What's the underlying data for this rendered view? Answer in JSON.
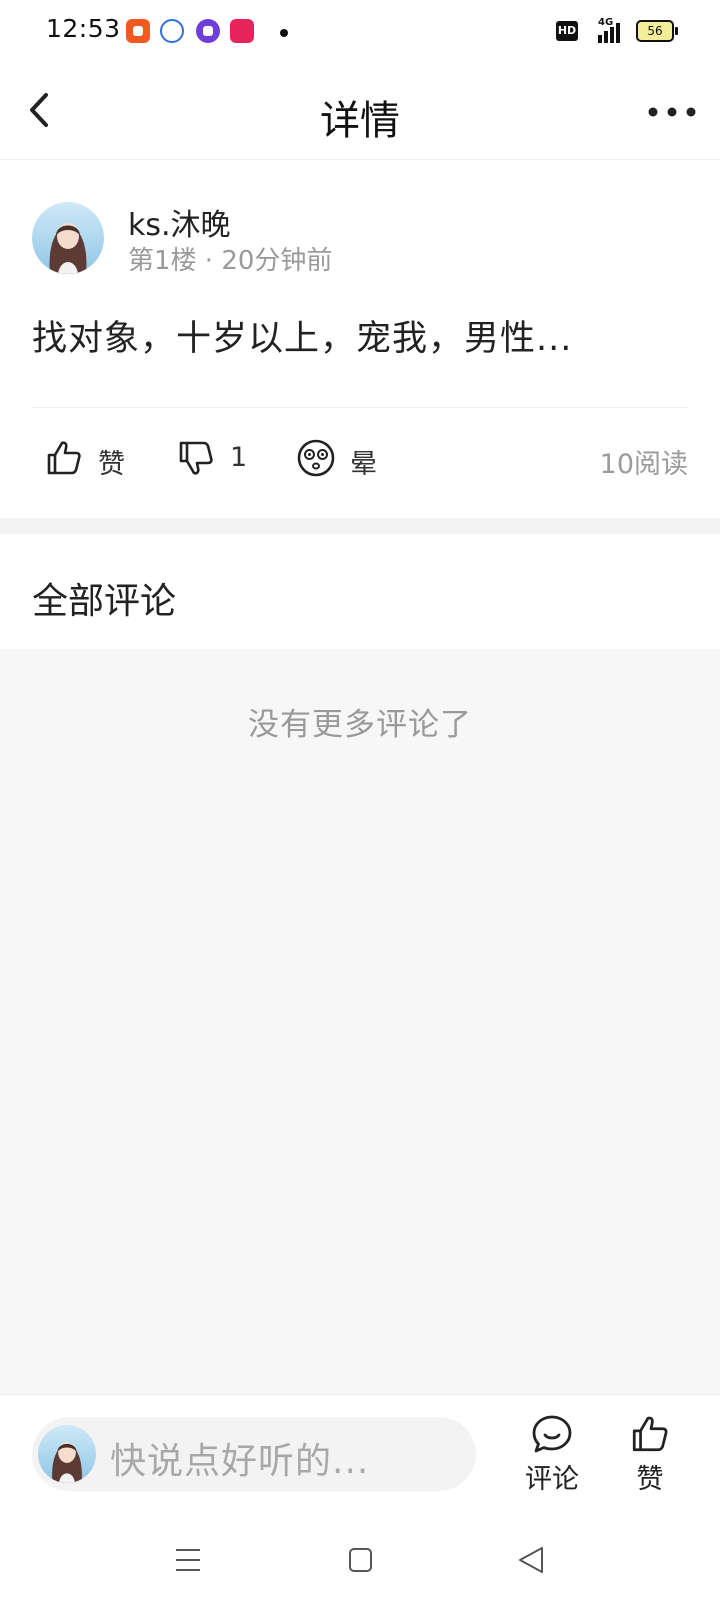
{
  "status_bar": {
    "time": "12:53",
    "network": "4G",
    "hd": "HD",
    "battery": "56"
  },
  "header": {
    "title": "详情"
  },
  "post": {
    "author": "ks.沐晚",
    "meta": "第1楼 · 20分钟前",
    "content": "找对象，十岁以上，宠我，男性...",
    "like_label": "赞",
    "dislike_count": "1",
    "dizzy_label": "晕",
    "read_count": "10阅读"
  },
  "comments": {
    "title": "全部评论",
    "empty_text": "没有更多评论了"
  },
  "bottom_bar": {
    "input_placeholder": "快说点好听的...",
    "comment_label": "评论",
    "like_label": "赞"
  },
  "colors": {
    "text_primary": "#222222",
    "text_secondary": "#9a9a9a",
    "divider": "#eeeeee",
    "section_bg": "#f7f7f7"
  },
  "icons": [
    "back-arrow-icon",
    "more-dots-icon",
    "thumbs-up-icon",
    "thumbs-down-icon",
    "dizzy-face-icon",
    "comment-bubble-icon",
    "menu-lines-icon",
    "home-square-icon",
    "back-triangle-icon"
  ]
}
